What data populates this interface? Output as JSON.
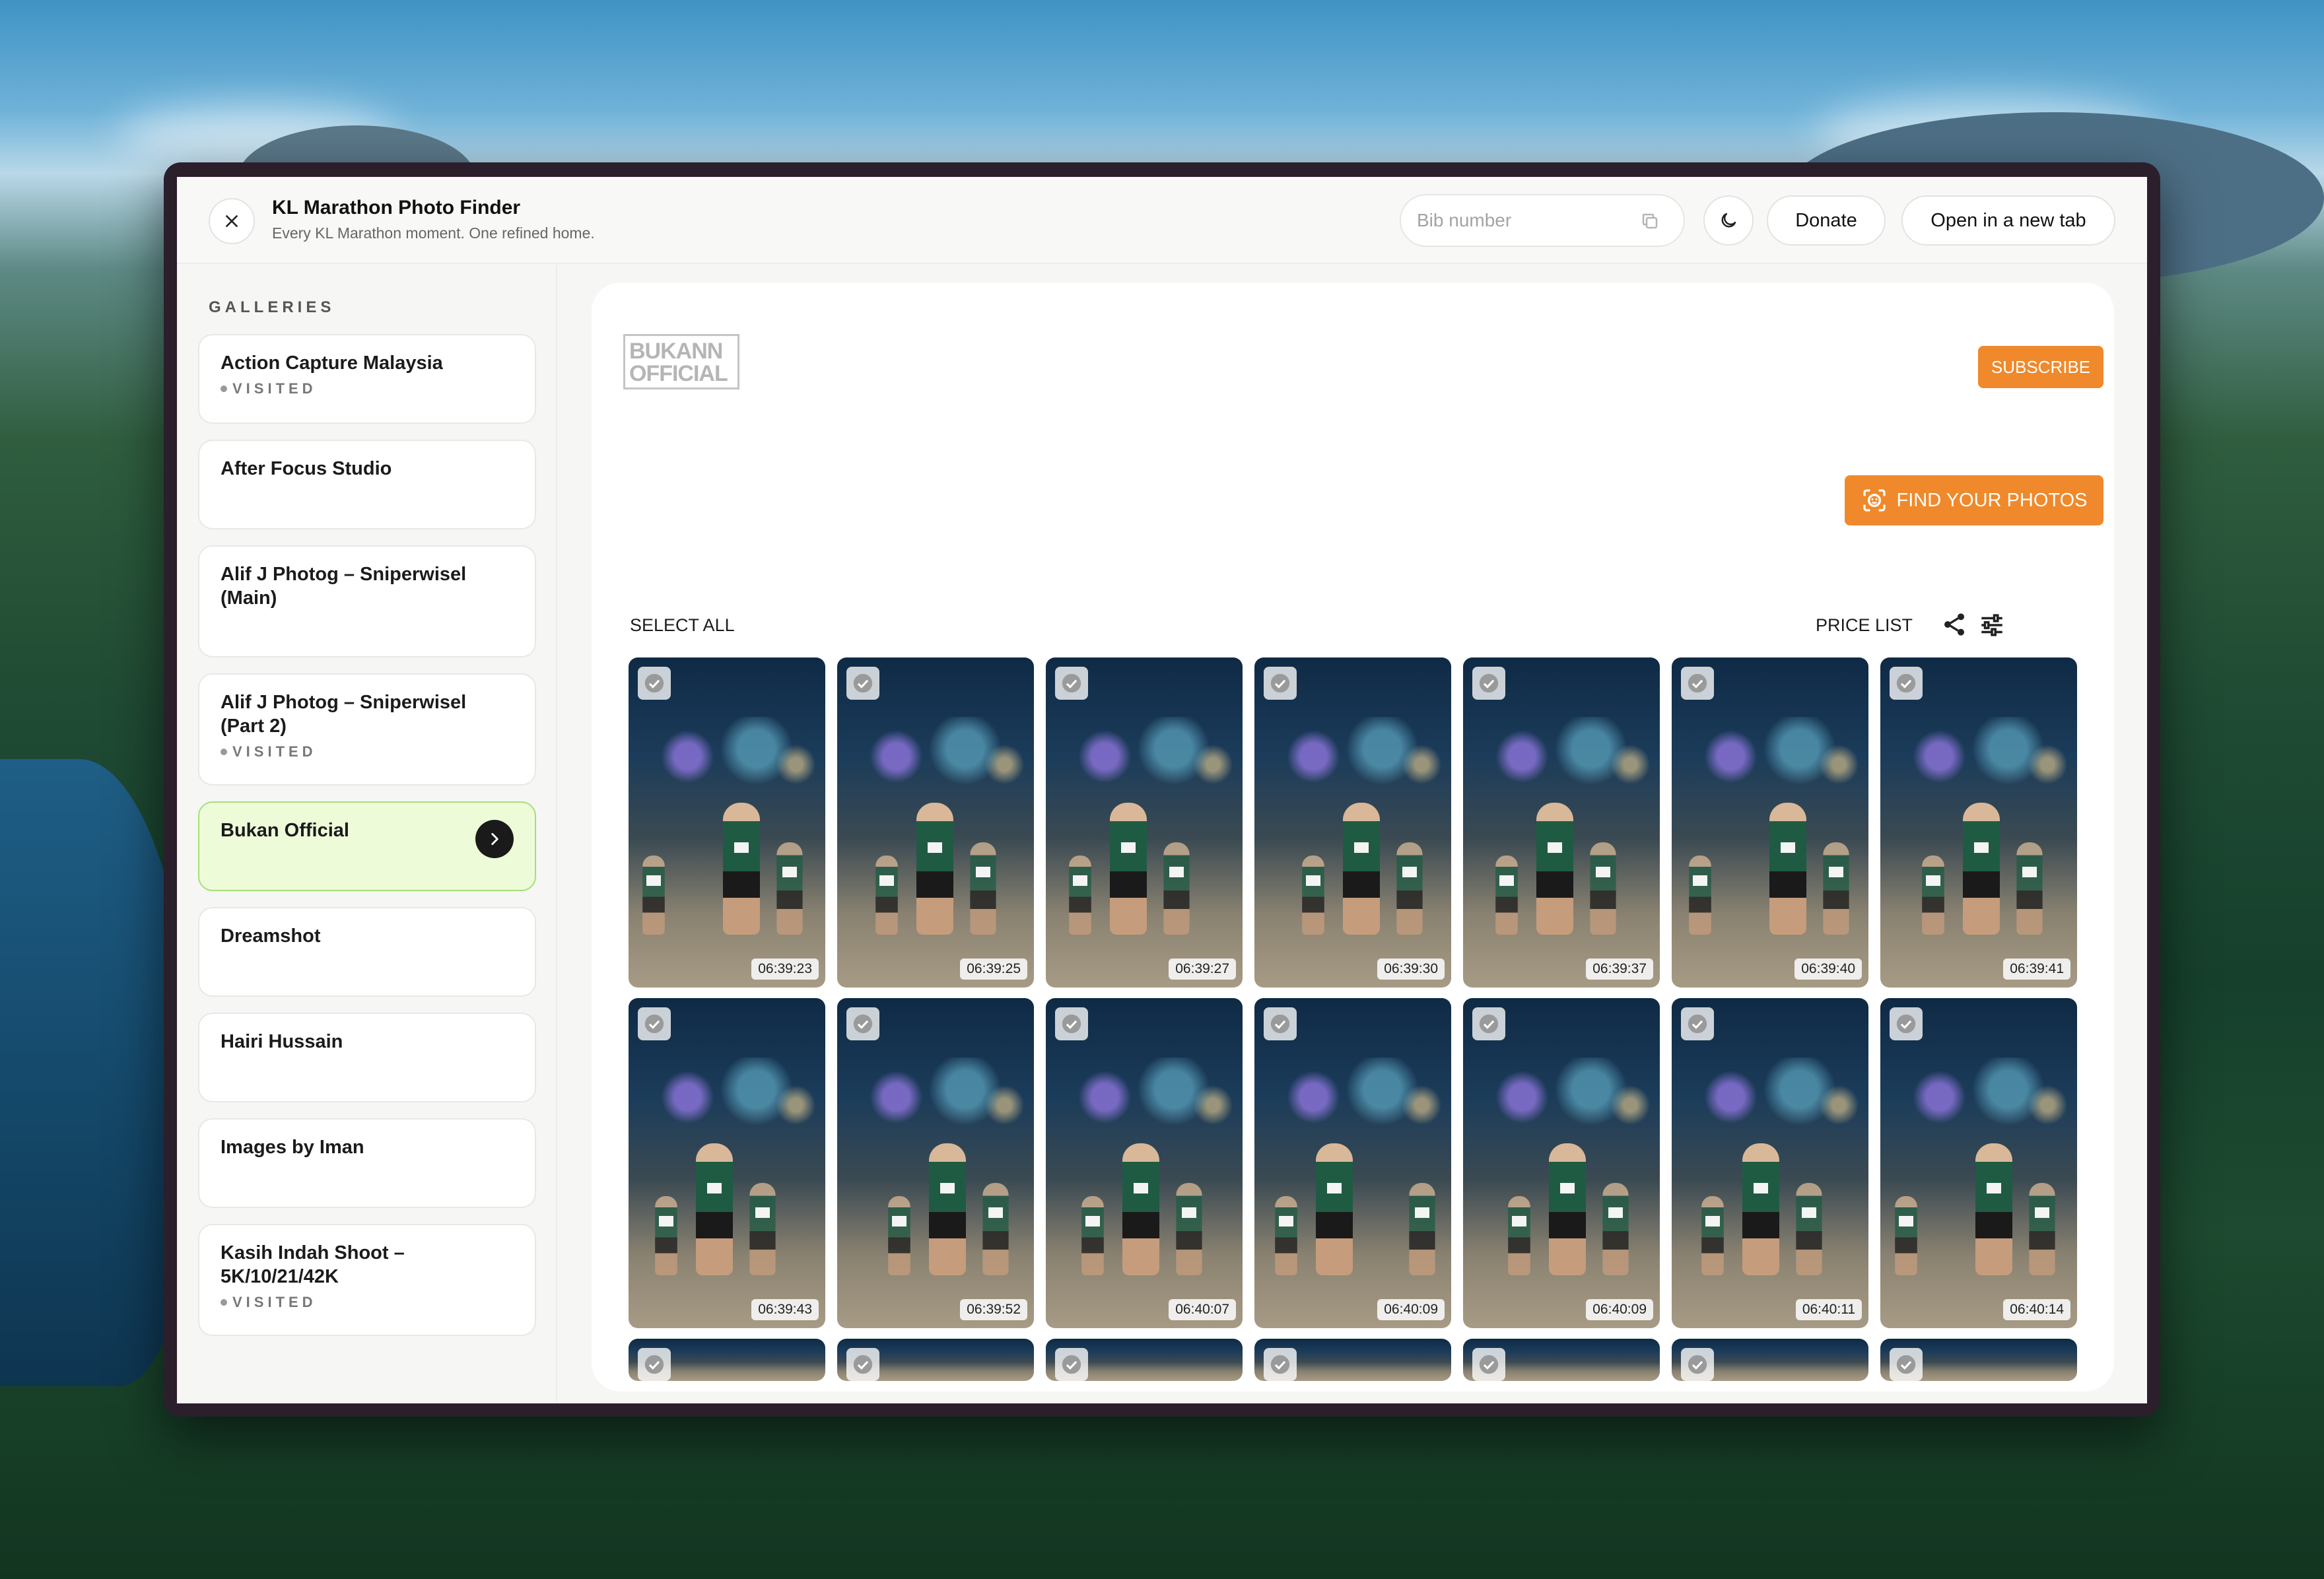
{
  "app": {
    "title": "KL Marathon Photo Finder",
    "subtitle": "Every KL Marathon moment. One refined home."
  },
  "header": {
    "bib_placeholder": "Bib number",
    "bib_value": "",
    "donate_label": "Donate",
    "open_new_tab_label": "Open in a new tab"
  },
  "sidebar": {
    "title": "GALLERIES",
    "visited_label": "VISITED",
    "items": [
      {
        "name": "Action Capture Malaysia",
        "visited": true,
        "active": false
      },
      {
        "name": "After Focus Studio",
        "visited": false,
        "active": false
      },
      {
        "name": "Alif J Photog – Sniperwisel (Main)",
        "visited": false,
        "active": false
      },
      {
        "name": "Alif J Photog – Sniperwisel (Part 2)",
        "visited": true,
        "active": false
      },
      {
        "name": "Bukan Official",
        "visited": false,
        "active": true
      },
      {
        "name": "Dreamshot",
        "visited": false,
        "active": false
      },
      {
        "name": "Hairi Hussain",
        "visited": false,
        "active": false
      },
      {
        "name": "Images by Iman",
        "visited": false,
        "active": false
      },
      {
        "name": "Kasih Indah Shoot – 5K/10/21/42K",
        "visited": true,
        "active": false
      }
    ]
  },
  "main": {
    "logo_text": [
      "BUKANN",
      "OFFICIAL"
    ],
    "subscribe_label": "SUBSCRIBE",
    "find_photos_label": "FIND YOUR PHOTOS",
    "select_all_label": "SELECT ALL",
    "price_list_label": "PRICE LIST",
    "photos": [
      "06:39:23",
      "06:39:25",
      "06:39:27",
      "06:39:30",
      "06:39:37",
      "06:39:40",
      "06:39:41",
      "06:39:43",
      "06:39:52",
      "06:40:07",
      "06:40:09",
      "06:40:09",
      "06:40:11",
      "06:40:14"
    ],
    "partial_row_count": 7
  },
  "colors": {
    "accent_orange": "#f0892b",
    "active_gallery_bg": "#eefbd9",
    "active_gallery_border": "#a4e077"
  },
  "icons": {
    "close": "close-icon",
    "copy": "copy-icon",
    "theme": "moon-icon",
    "go": "chevron-right-icon",
    "face_scan": "face-scan-icon",
    "share": "share-icon",
    "filter": "sliders-icon",
    "checkbox": "check-icon"
  }
}
